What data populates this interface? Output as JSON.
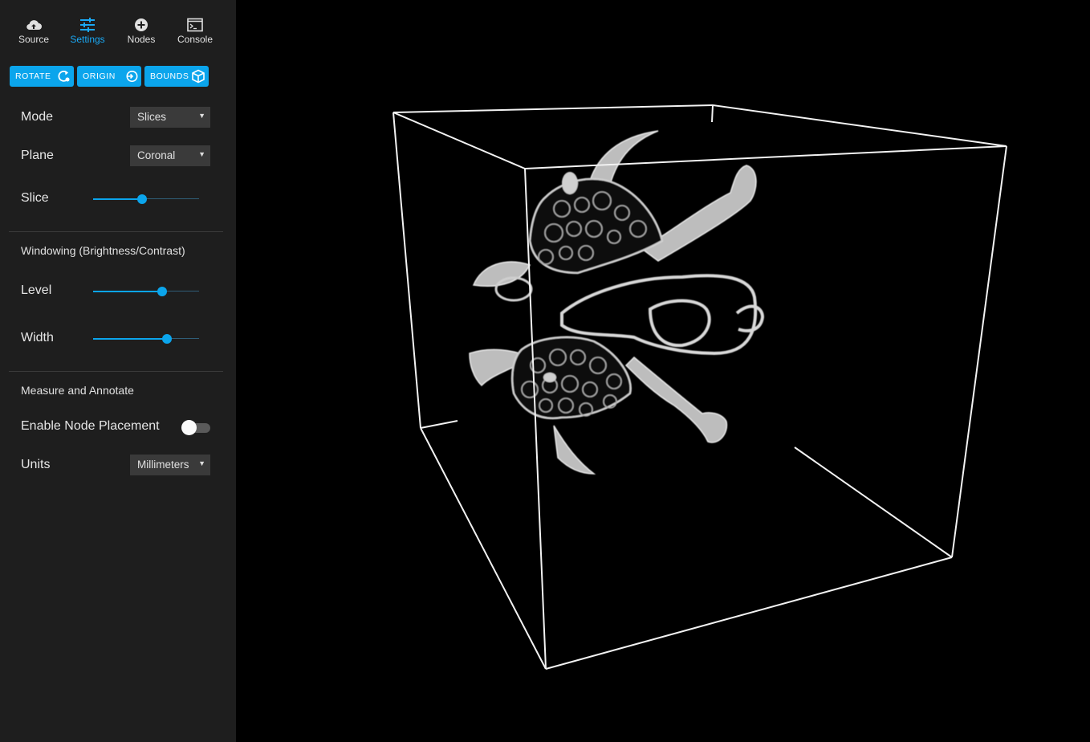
{
  "nav": {
    "tabs": [
      {
        "label": "Source",
        "icon": "cloud-upload-icon"
      },
      {
        "label": "Settings",
        "icon": "sliders-icon",
        "active": true
      },
      {
        "label": "Nodes",
        "icon": "plus-circle-icon"
      },
      {
        "label": "Console",
        "icon": "terminal-icon"
      }
    ]
  },
  "actions": [
    {
      "label": "ROTATE",
      "icon": "rotate-icon"
    },
    {
      "label": "ORIGIN",
      "icon": "origin-icon"
    },
    {
      "label": "BOUNDS",
      "icon": "cube-icon"
    }
  ],
  "settings": {
    "mode": {
      "label": "Mode",
      "value": "Slices"
    },
    "plane": {
      "label": "Plane",
      "value": "Coronal"
    },
    "slice": {
      "label": "Slice",
      "value_pct": 46
    },
    "windowing_title": "Windowing (Brightness/Contrast)",
    "level": {
      "label": "Level",
      "value_pct": 65
    },
    "width": {
      "label": "Width",
      "value_pct": 70
    },
    "measure_title": "Measure and Annotate",
    "node_placement": {
      "label": "Enable Node Placement",
      "enabled": false
    },
    "units": {
      "label": "Units",
      "value": "Millimeters"
    }
  },
  "colors": {
    "accent": "#0ba5ec",
    "sidebar_bg": "#1e1e1e",
    "viewport_bg": "#000000",
    "select_bg": "#3a3a3a"
  }
}
